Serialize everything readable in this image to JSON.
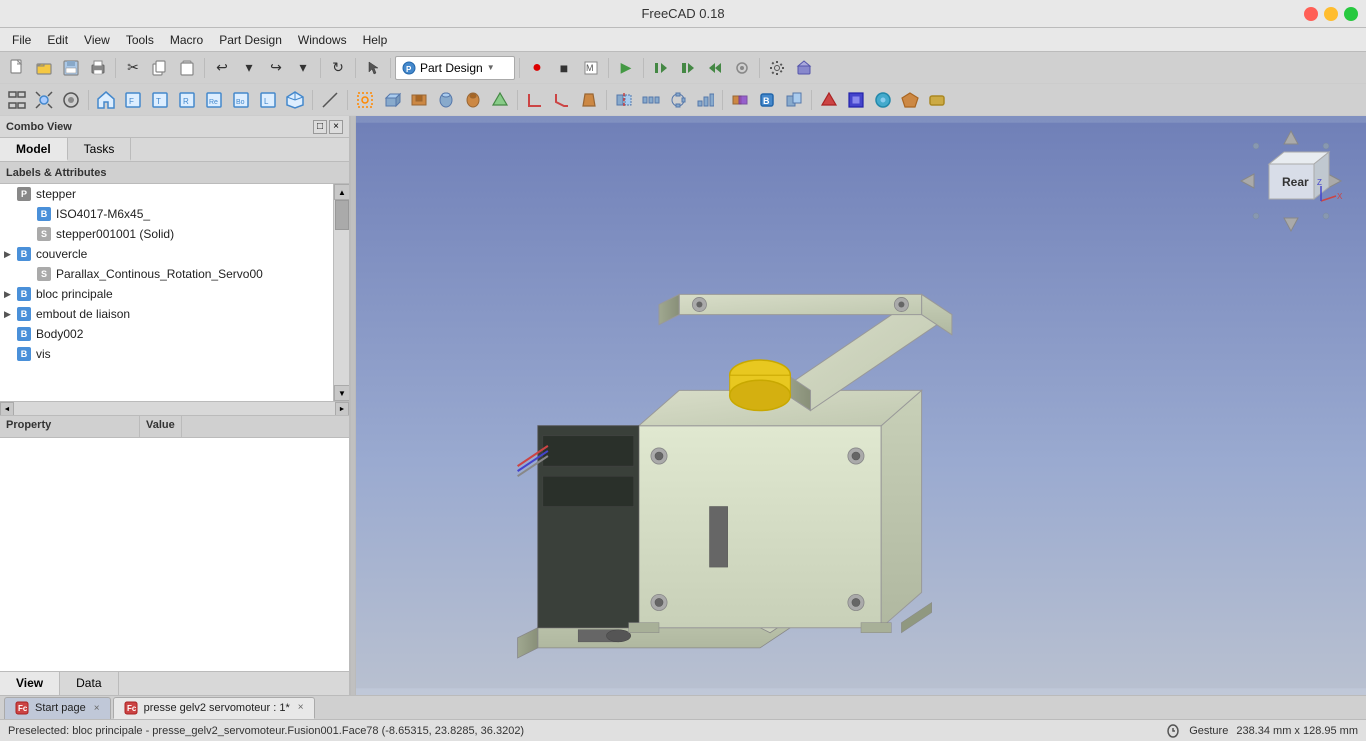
{
  "titlebar": {
    "title": "FreeCAD 0.18"
  },
  "menubar": {
    "items": [
      "File",
      "Edit",
      "View",
      "Tools",
      "Macro",
      "Part Design",
      "Windows",
      "Help"
    ]
  },
  "toolbar1": {
    "items": [
      "new",
      "open",
      "save",
      "print",
      "cut",
      "copy",
      "paste",
      "undo",
      "redo",
      "refresh",
      "pointer"
    ],
    "dropdown_label": "Part Design",
    "record_btn": "●",
    "stop_btn": "■",
    "macro_edit": "📝",
    "run_btn": "▶",
    "debug1": "⏮",
    "debug2": "⏭",
    "debug3": "⏩",
    "debug4": "⏺",
    "settings": "⚙"
  },
  "toolbar2": {
    "items": [
      "fit_all",
      "fit_sel",
      "draw_style",
      "home",
      "front",
      "top",
      "right",
      "rear",
      "bottom",
      "left",
      "isometric",
      "measure",
      "sketch",
      "constraint1",
      "constraint2"
    ]
  },
  "left_panel": {
    "combo_view_title": "Combo View",
    "tabs": [
      "Model",
      "Tasks"
    ],
    "active_tab": "Model",
    "tree_header": "Labels & Attributes",
    "tree_items": [
      {
        "id": 1,
        "indent": 0,
        "arrow": "",
        "icon": "part",
        "label": "stepper",
        "type": "part"
      },
      {
        "id": 2,
        "indent": 1,
        "arrow": "",
        "icon": "body",
        "label": "ISO4017-M6x45_",
        "type": "body"
      },
      {
        "id": 3,
        "indent": 1,
        "arrow": "",
        "icon": "solid",
        "label": "stepper001001 (Solid)",
        "type": "solid"
      },
      {
        "id": 4,
        "indent": 0,
        "arrow": "▶",
        "icon": "body",
        "label": "couvercle",
        "type": "body"
      },
      {
        "id": 5,
        "indent": 1,
        "arrow": "",
        "icon": "solid",
        "label": "Parallax_Continous_Rotation_Servo00",
        "type": "solid"
      },
      {
        "id": 6,
        "indent": 0,
        "arrow": "▶",
        "icon": "body",
        "label": "bloc principale",
        "type": "body"
      },
      {
        "id": 7,
        "indent": 0,
        "arrow": "▶",
        "icon": "body",
        "label": "embout de liaison",
        "type": "body"
      },
      {
        "id": 8,
        "indent": 0,
        "arrow": "",
        "icon": "body",
        "label": "Body002",
        "type": "body"
      },
      {
        "id": 9,
        "indent": 0,
        "arrow": "",
        "icon": "body",
        "label": "vis",
        "type": "body"
      }
    ],
    "property_columns": [
      "Property",
      "Value"
    ],
    "bottom_tabs": [
      "View",
      "Data"
    ],
    "active_bottom_tab": "View"
  },
  "viewport": {
    "bg_top": "#7080b8",
    "bg_bottom": "#b8c0d0"
  },
  "nav_cube": {
    "label": "Rear"
  },
  "doc_tabs": [
    {
      "label": "Start page",
      "icon": "fc",
      "closable": true,
      "active": false
    },
    {
      "label": "presse gelv2 servomoteur : 1*",
      "icon": "fc",
      "closable": true,
      "active": true
    }
  ],
  "statusbar": {
    "message": "Preselected: bloc principale - presse_gelv2_servomoteur.Fusion001.Face78 (-8.65315, 23.8285, 36.3202)",
    "gesture": "Gesture",
    "dimensions": "238.34 mm x 128.95 mm"
  }
}
